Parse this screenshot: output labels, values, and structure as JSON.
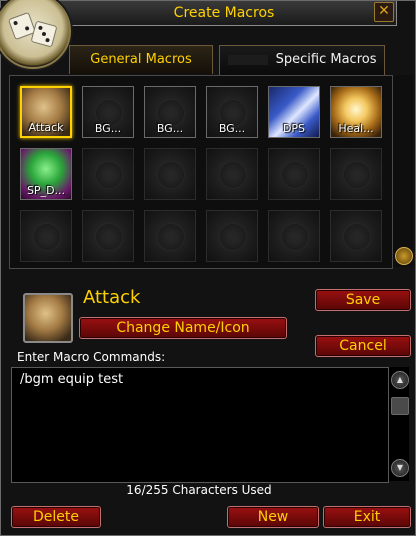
{
  "window": {
    "title": "Create Macros"
  },
  "tabs": [
    {
      "label": "General Macros"
    },
    {
      "label": "Specific Macros"
    }
  ],
  "slots": [
    {
      "label": "Attack"
    },
    {
      "label": "BG..."
    },
    {
      "label": "BG..."
    },
    {
      "label": "BG..."
    },
    {
      "label": "DPS"
    },
    {
      "label": "Heal..."
    },
    {
      "label": "SP_D..."
    }
  ],
  "selected": {
    "name": "Attack",
    "change_label": "Change Name/Icon"
  },
  "buttons": {
    "save": "Save",
    "cancel": "Cancel",
    "delete": "Delete",
    "new": "New",
    "exit": "Exit"
  },
  "editor": {
    "label": "Enter Macro Commands:",
    "text": "/bgm equip test",
    "char_count": "16/255 Characters Used"
  },
  "icons": {
    "close": "close-icon",
    "portrait": "dice-icon"
  }
}
